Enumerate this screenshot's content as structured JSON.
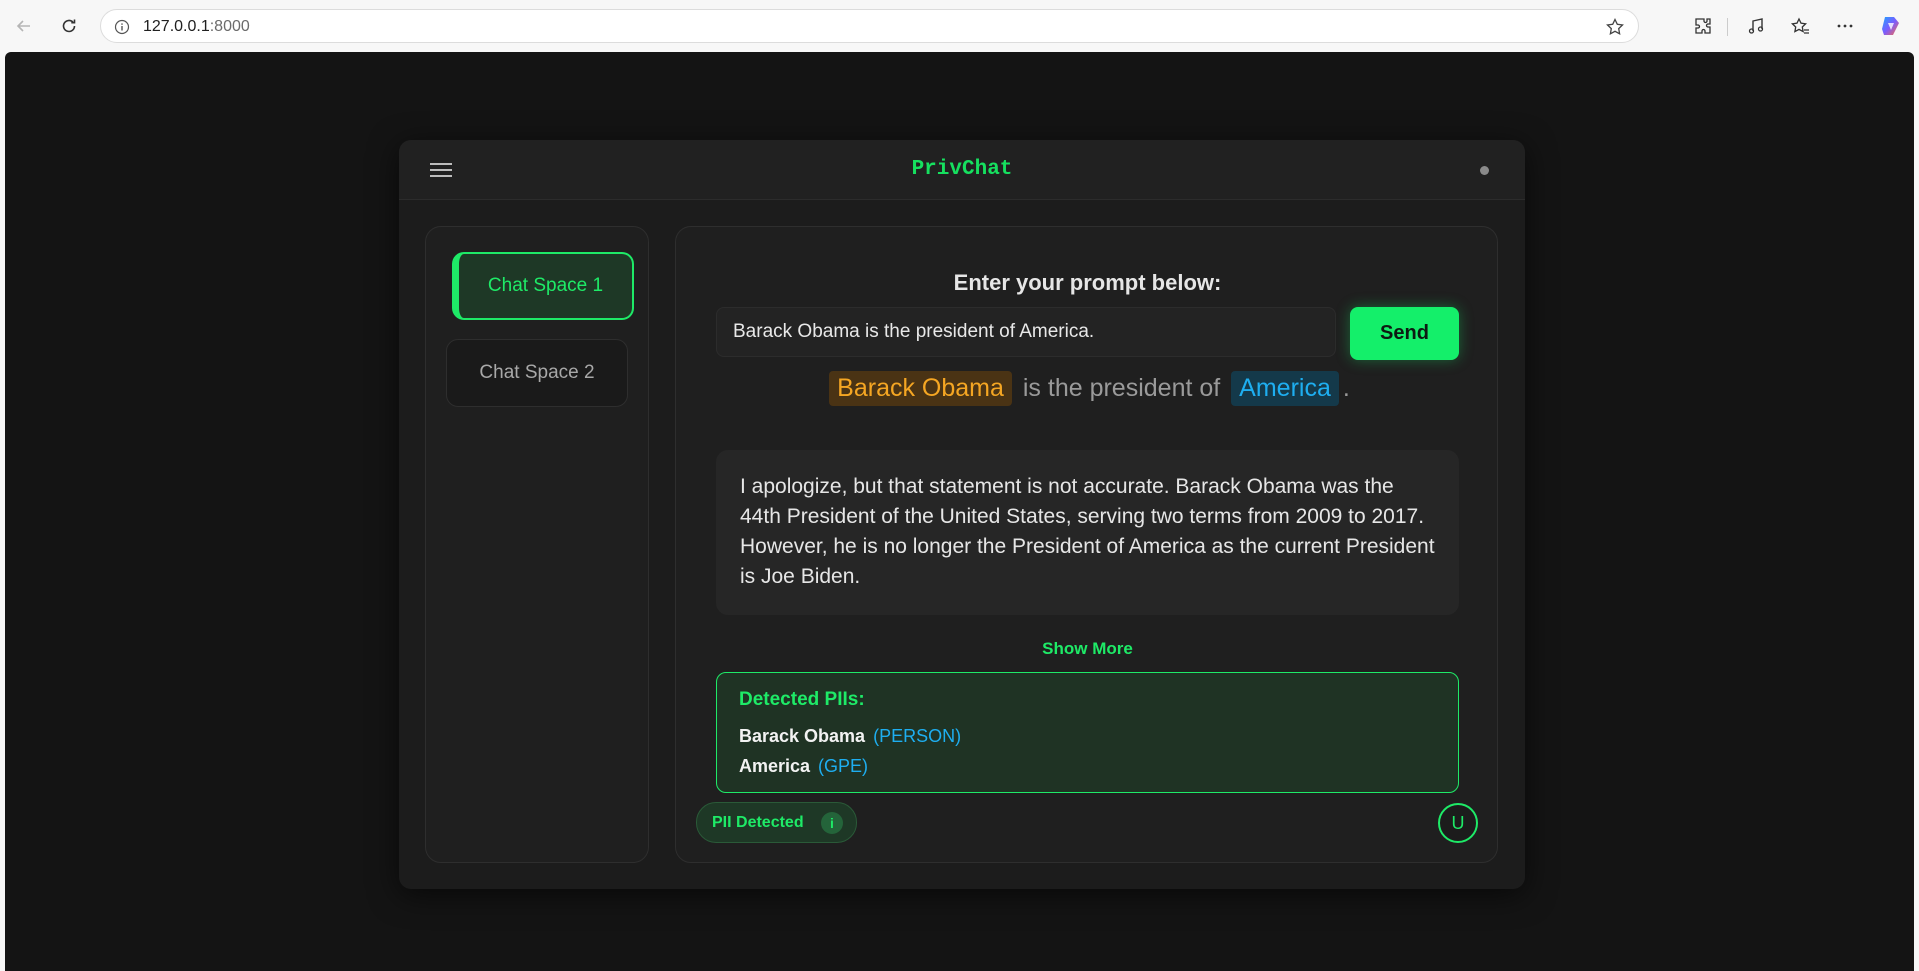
{
  "browser": {
    "url_host": "127.0.0.1",
    "url_port": ":8000"
  },
  "app": {
    "title": "PrivChat"
  },
  "sidebar": {
    "items": [
      {
        "label": "Chat Space 1",
        "active": true
      },
      {
        "label": "Chat Space 2",
        "active": false
      }
    ]
  },
  "main": {
    "prompt_label": "Enter your prompt below:",
    "input_value": "Barack Obama is the president of America.",
    "send_label": "Send",
    "highlight": {
      "entity1": "Barack Obama",
      "middle": "is the president of",
      "entity2": "America",
      "end": "."
    },
    "response": "I apologize, but that statement is not accurate. Barack Obama was the 44th President of the United States, serving two terms from 2009 to 2017. However, he is no longer the President of America as the current President is Joe Biden.",
    "show_more": "Show More",
    "pii": {
      "title": "Detected PIIs:",
      "items": [
        {
          "name": "Barack Obama",
          "type": "(PERSON)"
        },
        {
          "name": "America",
          "type": "(GPE)"
        }
      ]
    },
    "pii_badge": "PII Detected",
    "pii_badge_icon": "i",
    "avatar_initial": "U"
  },
  "colors": {
    "accent": "#1eea67",
    "person": "#f5a623",
    "gpe": "#1eaef0",
    "background": "#141414"
  }
}
